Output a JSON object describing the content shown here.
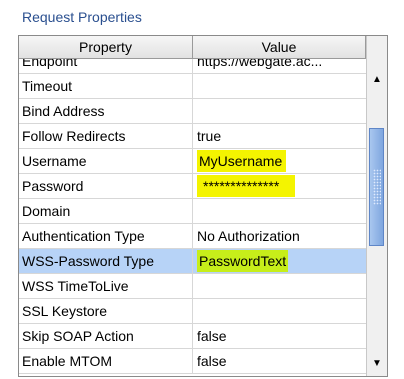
{
  "panel": {
    "title": "Request Properties"
  },
  "table": {
    "columns": {
      "property": "Property",
      "value": "Value"
    },
    "rows": [
      {
        "property": "Endpoint",
        "value": "https://webgate.ac..."
      },
      {
        "property": "Timeout",
        "value": ""
      },
      {
        "property": "Bind Address",
        "value": ""
      },
      {
        "property": "Follow Redirects",
        "value": "true"
      },
      {
        "property": "Username",
        "value": "MyUsername"
      },
      {
        "property": "Password",
        "value": "**************"
      },
      {
        "property": "Domain",
        "value": ""
      },
      {
        "property": "Authentication Type",
        "value": "No Authorization"
      },
      {
        "property": "WSS-Password Type",
        "value": "PasswordText"
      },
      {
        "property": "WSS TimeToLive",
        "value": ""
      },
      {
        "property": "SSL Keystore",
        "value": ""
      },
      {
        "property": "Skip SOAP Action",
        "value": "false"
      },
      {
        "property": "Enable MTOM",
        "value": "false"
      }
    ]
  },
  "highlight_colors": {
    "yellow": "#f4f400",
    "green": "#c7ee1a",
    "selection": "#b7d3f7"
  },
  "icons": {
    "scroll_up": "triangle-up-icon",
    "scroll_down": "triangle-down-icon"
  }
}
